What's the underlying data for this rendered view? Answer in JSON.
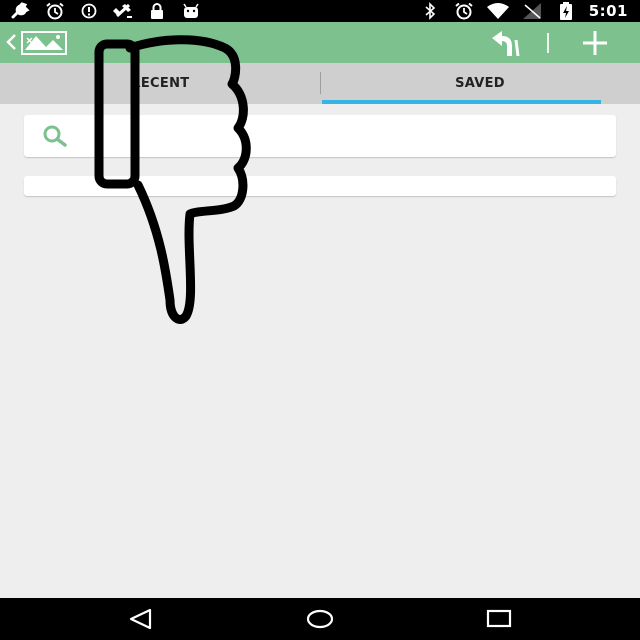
{
  "tabs": [
    {
      "label": "RECENT",
      "selected": false
    },
    {
      "label": "SAVED",
      "selected": true
    }
  ],
  "status_bar": {
    "time": "5:01",
    "left_icons": [
      "wrench-icon",
      "alarm-icon",
      "sync-icon",
      "gps-off-icon",
      "lock-icon",
      "android-icon"
    ],
    "right_icons": [
      "bluetooth-icon",
      "alarm-icon",
      "wifi-icon",
      "signal-icon",
      "battery-charging-icon"
    ]
  },
  "action_bar": {
    "icons": [
      "up-caret-icon",
      "map-logo-icon",
      "directions-icon",
      "add-icon"
    ]
  },
  "search": {
    "value": "",
    "placeholder": ""
  },
  "nav_bar": {
    "icons": [
      "back-icon",
      "home-icon",
      "recents-icon"
    ]
  },
  "colors": {
    "action_bar": "#7dc18f",
    "tab_bar": "#cfcfcf",
    "tab_indicator": "#33b5e5",
    "background": "#eeeeee",
    "search_icon": "#7dc18f",
    "status_bar": "#000000"
  }
}
